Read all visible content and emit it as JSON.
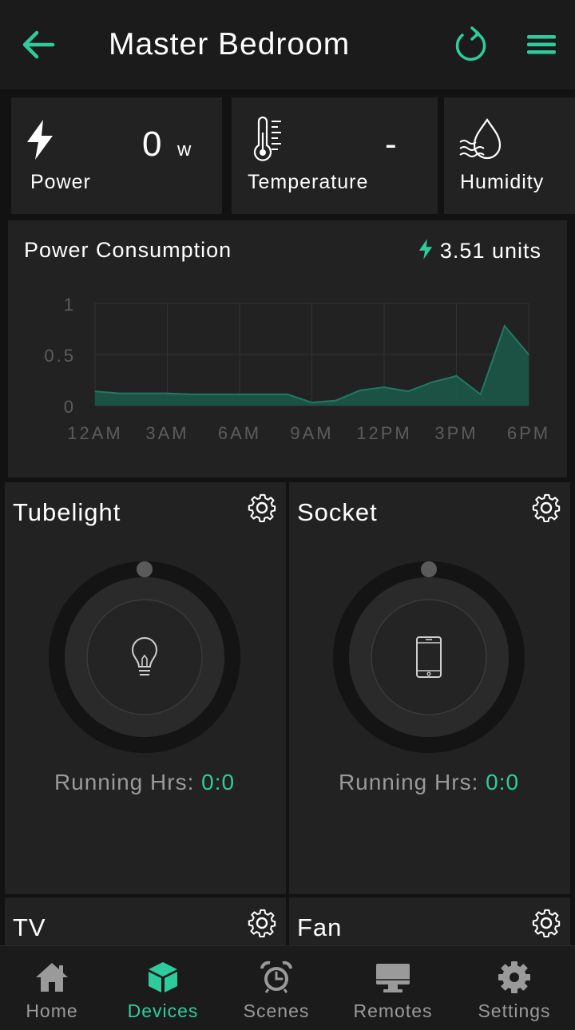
{
  "header": {
    "title": "Master Bedroom",
    "back_icon": "arrow-left-icon",
    "refresh_icon": "refresh-icon",
    "menu_icon": "hamburger-menu-icon"
  },
  "stats": {
    "power": {
      "label": "Power",
      "value": "0",
      "unit": "w",
      "icon": "lightning-bolt-icon"
    },
    "temperature": {
      "label": "Temperature",
      "value": "-",
      "icon": "thermometer-icon"
    },
    "humidity": {
      "label": "Humidity",
      "icon": "water-drop-icon"
    }
  },
  "consumption": {
    "title": "Power Consumption",
    "total": "3.51 units",
    "icon": "lightning-bolt-icon"
  },
  "chart_data": {
    "type": "area",
    "x_ticks": [
      "12AM",
      "3AM",
      "6AM",
      "9AM",
      "12PM",
      "3PM",
      "6PM"
    ],
    "y_ticks": [
      "1",
      "0.5",
      "0"
    ],
    "ylim": [
      0,
      1
    ],
    "grid": true,
    "series": [
      {
        "x_hours": [
          0,
          1,
          2,
          3,
          4,
          5,
          6,
          7,
          8,
          9,
          10,
          11,
          12,
          13,
          14,
          15,
          16,
          17,
          18
        ],
        "values": [
          0.14,
          0.12,
          0.12,
          0.12,
          0.11,
          0.11,
          0.11,
          0.11,
          0.11,
          0.03,
          0.05,
          0.15,
          0.18,
          0.14,
          0.23,
          0.29,
          0.11,
          0.78,
          0.5
        ]
      }
    ],
    "colors": {
      "line": "#1f7a63",
      "fill": "#1b5a4a"
    }
  },
  "devices": [
    {
      "name": "Tubelight",
      "icon": "light-bulb-icon",
      "running_label": "Running Hrs:",
      "running_value": "0:0"
    },
    {
      "name": "Socket",
      "icon": "smartphone-icon",
      "running_label": "Running Hrs:",
      "running_value": "0:0"
    },
    {
      "name": "TV"
    },
    {
      "name": "Fan"
    }
  ],
  "nav": [
    {
      "label": "Home",
      "icon": "home-icon",
      "active": false
    },
    {
      "label": "Devices",
      "icon": "cube-icon",
      "active": true
    },
    {
      "label": "Scenes",
      "icon": "alarm-clock-icon",
      "active": false
    },
    {
      "label": "Remotes",
      "icon": "monitor-icon",
      "active": false
    },
    {
      "label": "Settings",
      "icon": "gear-icon",
      "active": false
    }
  ],
  "colors": {
    "accent": "#2ecc9c",
    "card": "#222222",
    "background": "#121212",
    "bar": "#1b1b1b"
  }
}
